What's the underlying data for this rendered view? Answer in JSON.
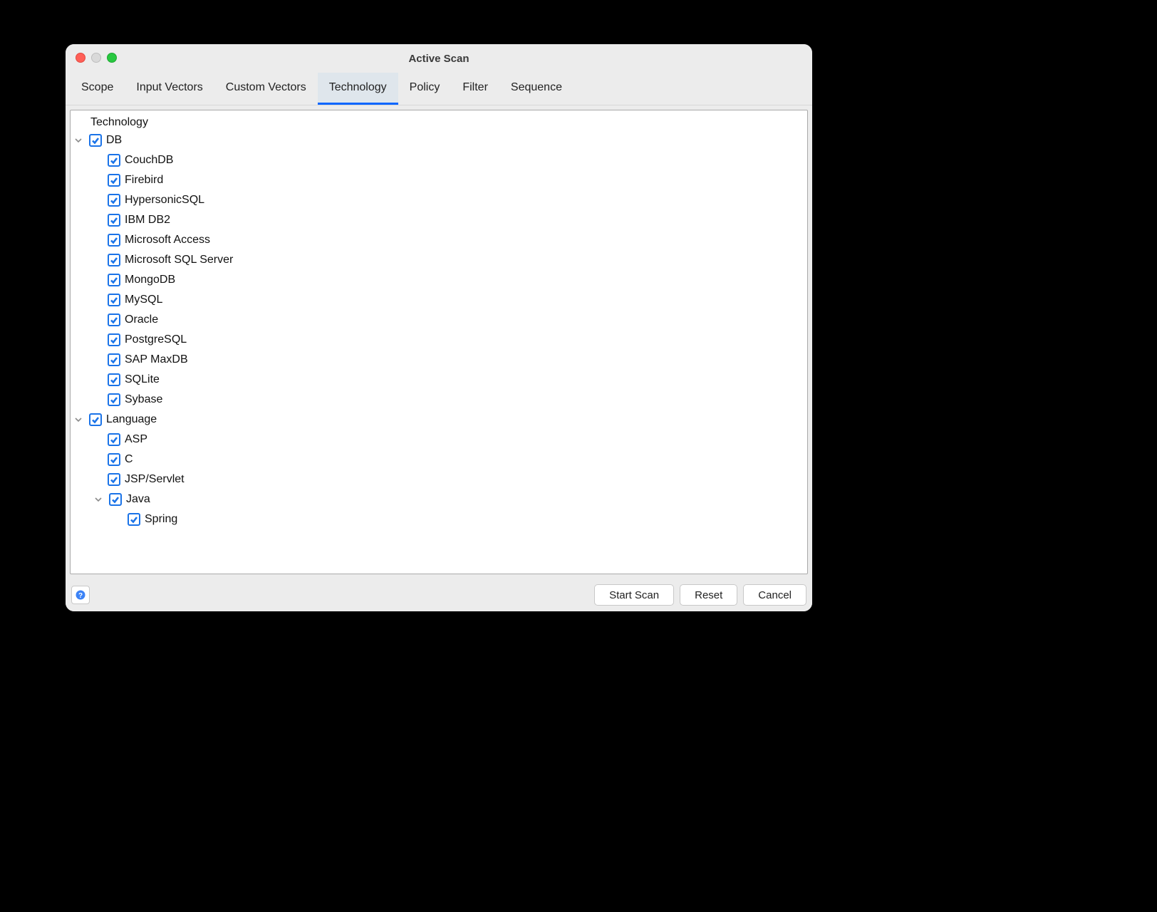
{
  "window": {
    "title": "Active Scan"
  },
  "tabs": [
    {
      "label": "Scope",
      "selected": false
    },
    {
      "label": "Input Vectors",
      "selected": false
    },
    {
      "label": "Custom Vectors",
      "selected": false
    },
    {
      "label": "Technology",
      "selected": true
    },
    {
      "label": "Policy",
      "selected": false
    },
    {
      "label": "Filter",
      "selected": false
    },
    {
      "label": "Sequence",
      "selected": false
    }
  ],
  "tree": {
    "root_label": "Technology",
    "groups": [
      {
        "label": "DB",
        "checked": true,
        "expanded": true,
        "children": [
          {
            "label": "CouchDB",
            "checked": true
          },
          {
            "label": "Firebird",
            "checked": true
          },
          {
            "label": "HypersonicSQL",
            "checked": true
          },
          {
            "label": "IBM DB2",
            "checked": true
          },
          {
            "label": "Microsoft Access",
            "checked": true
          },
          {
            "label": "Microsoft SQL Server",
            "checked": true
          },
          {
            "label": "MongoDB",
            "checked": true
          },
          {
            "label": "MySQL",
            "checked": true
          },
          {
            "label": "Oracle",
            "checked": true
          },
          {
            "label": "PostgreSQL",
            "checked": true
          },
          {
            "label": "SAP MaxDB",
            "checked": true
          },
          {
            "label": "SQLite",
            "checked": true
          },
          {
            "label": "Sybase",
            "checked": true
          }
        ]
      },
      {
        "label": "Language",
        "checked": true,
        "expanded": true,
        "children": [
          {
            "label": "ASP",
            "checked": true
          },
          {
            "label": "C",
            "checked": true
          },
          {
            "label": "JSP/Servlet",
            "checked": true
          },
          {
            "label": "Java",
            "checked": true,
            "expanded": true,
            "children": [
              {
                "label": "Spring",
                "checked": true
              }
            ]
          }
        ]
      }
    ]
  },
  "footer": {
    "start_scan": "Start Scan",
    "reset": "Reset",
    "cancel": "Cancel"
  }
}
